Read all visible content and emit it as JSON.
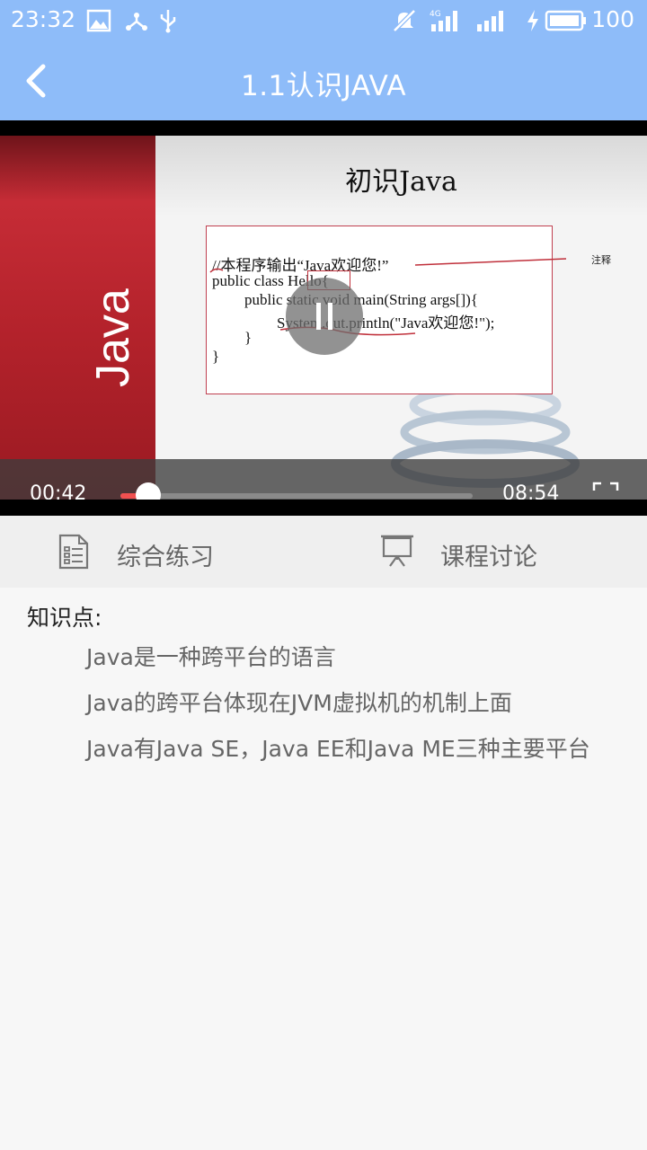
{
  "status_bar": {
    "time": "23:32",
    "network": "4G",
    "battery": "100",
    "icons": [
      "image-icon",
      "share-icon",
      "usb-icon",
      "mute-icon",
      "signal-4g-icon",
      "signal-icon",
      "charging-icon",
      "battery-icon"
    ]
  },
  "header": {
    "title": "1.1认识JAVA",
    "back_icon": "chevron-left-icon",
    "background_color": "#8ebcf9"
  },
  "video": {
    "slide": {
      "band_text": "Java",
      "title": "初识Java",
      "code_lines": [
        "//本程序输出“Java欢迎您!”",
        "public class Hello{",
        "public static void main(String args[]){",
        "System.out.println(\"Java欢迎您!\");",
        "}",
        "}"
      ],
      "annotation": "注释"
    },
    "current_time": "00:42",
    "total_time": "08:54",
    "progress": 0.08,
    "progress_color": "#f05050",
    "state": "playing"
  },
  "tabs": [
    {
      "label": "综合练习",
      "icon": "exercise-list-icon"
    },
    {
      "label": "课程讨论",
      "icon": "presentation-icon"
    }
  ],
  "knowledge": {
    "heading": "知识点:",
    "items": [
      "Java是一种跨平台的语言",
      "Java的跨平台体现在JVM虚拟机的机制上面",
      "Java有Java SE，Java EE和Java ME三种主要平台"
    ]
  }
}
